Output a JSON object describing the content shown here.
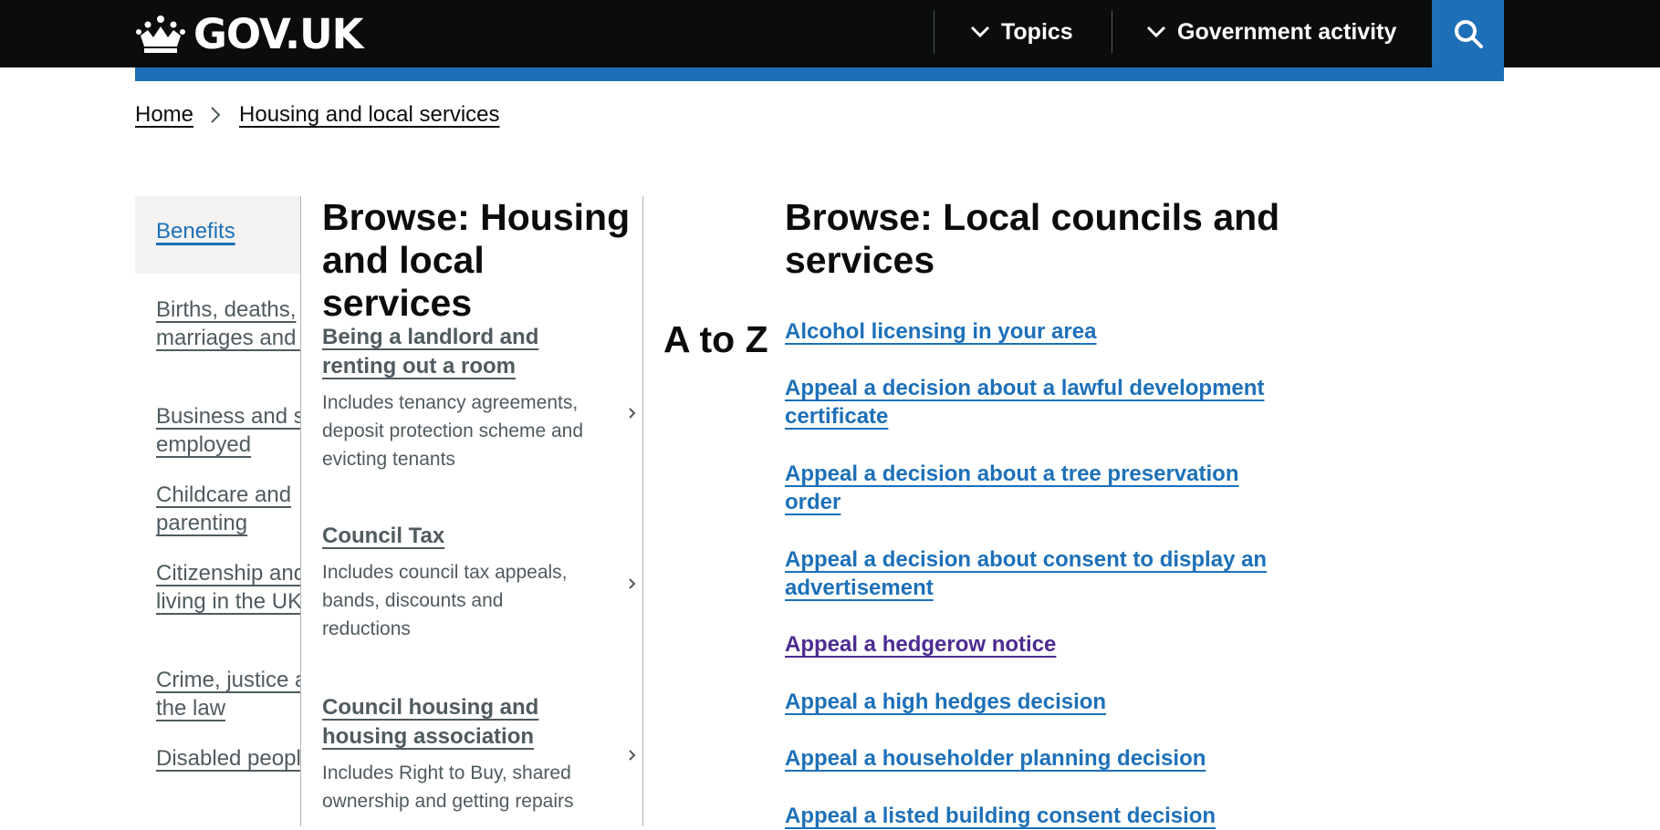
{
  "header": {
    "logo_text": "GOV.UK",
    "nav": [
      {
        "label": "Topics"
      },
      {
        "label": "Government activity"
      }
    ],
    "search_icon": "search-icon"
  },
  "breadcrumb": [
    {
      "label": "Home"
    },
    {
      "label": "Housing and local services"
    }
  ],
  "topics": [
    {
      "label": "Benefits",
      "selected": true
    },
    {
      "label": "Births, deaths, marriages and care"
    },
    {
      "label": "Business and self-employed"
    },
    {
      "label": "Childcare and parenting"
    },
    {
      "label": "Citizenship and living in the UK"
    },
    {
      "label": "Crime, justice and the law"
    },
    {
      "label": "Disabled people"
    }
  ],
  "middle": {
    "title": "Browse: Housing and local services",
    "items": [
      {
        "title": "Being a landlord and renting out a room",
        "desc": "Includes tenancy agreements, deposit protection scheme and evicting tenants"
      },
      {
        "title": "Council Tax",
        "desc": "Includes council tax appeals, bands, discounts and reductions"
      },
      {
        "title": "Council housing and housing association",
        "desc": "Includes Right to Buy, shared ownership and getting repairs"
      }
    ]
  },
  "right": {
    "title": "Browse: Local councils and services",
    "atoz_label": "A to Z",
    "links": [
      {
        "label": "Alcohol licensing in your area"
      },
      {
        "label": "Appeal a decision about a lawful development certificate"
      },
      {
        "label": "Appeal a decision about a tree preservation order"
      },
      {
        "label": "Appeal a decision about consent to display an advertisement"
      },
      {
        "label": "Appeal a hedgerow notice",
        "visited": true
      },
      {
        "label": "Appeal a high hedges decision"
      },
      {
        "label": "Appeal a householder planning decision"
      },
      {
        "label": "Appeal a listed building consent decision"
      }
    ]
  },
  "colors": {
    "header_bg": "#0b0c0c",
    "brand_blue": "#1d70b8",
    "visited_link": "#4c2c92",
    "secondary_text": "#505a5f",
    "active_bg": "#f3f2f1"
  }
}
